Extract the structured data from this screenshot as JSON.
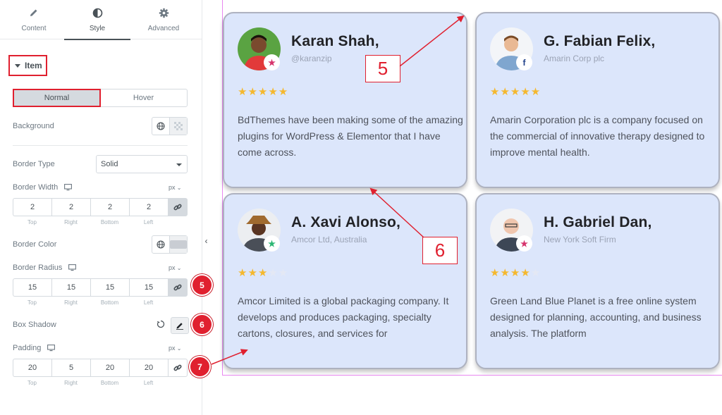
{
  "panel": {
    "tabs": [
      {
        "label": "Content",
        "icon": "pencil-icon"
      },
      {
        "label": "Style",
        "icon": "half-circle-icon"
      },
      {
        "label": "Advanced",
        "icon": "gear-icon"
      }
    ],
    "section_title": "Item",
    "states": [
      "Normal",
      "Hover"
    ],
    "background_label": "Background",
    "border_type_label": "Border Type",
    "border_type_value": "Solid",
    "border_width": {
      "label": "Border Width",
      "unit": "px",
      "values": [
        "2",
        "2",
        "2",
        "2"
      ]
    },
    "border_color_label": "Border Color",
    "border_radius": {
      "label": "Border Radius",
      "unit": "px",
      "values": [
        "15",
        "15",
        "15",
        "15"
      ]
    },
    "box_shadow_label": "Box Shadow",
    "padding": {
      "label": "Padding",
      "unit": "px",
      "values": [
        "20",
        "5",
        "20",
        "20"
      ]
    },
    "dim_captions": [
      "Top",
      "Right",
      "Bottom",
      "Left"
    ],
    "badges": [
      "5",
      "6",
      "7"
    ]
  },
  "cards": [
    {
      "name": "Karan Shah,",
      "handle": "@karanzip",
      "platform": "star",
      "rating": 5,
      "stars": "★★★★★",
      "empty": "",
      "text": "BdThemes have been making some of the amazing plugins for WordPress & Elementor that I have come across."
    },
    {
      "name": "G. Fabian Felix,",
      "handle": "Amarin Corp plc",
      "platform": "facebook",
      "rating": 5,
      "stars": "★★★★★",
      "empty": "",
      "text": "Amarin Corporation plc is a company focused on the commercial of innovative therapy designed to improve mental health."
    },
    {
      "name": "A. Xavi Alonso,",
      "handle": "Amcor Ltd, Australia",
      "platform": "star",
      "rating": 3,
      "stars": "★★★",
      "empty": "★★",
      "text": "Amcor Limited is a global packaging company. It develops and produces packaging, specialty cartons, closures, and services for"
    },
    {
      "name": "H. Gabriel Dan,",
      "handle": "New York Soft Firm",
      "platform": "star",
      "rating": 4,
      "stars": "★★★★",
      "empty": "★",
      "text": "Green Land Blue Planet is a free online system designed for planning, accounting, and business analysis. The platform"
    }
  ],
  "annotations": [
    "5",
    "6"
  ],
  "colors": {
    "accent_red": "#e0202f",
    "card_bg": "#dce6fb",
    "star": "#f5b82e"
  }
}
